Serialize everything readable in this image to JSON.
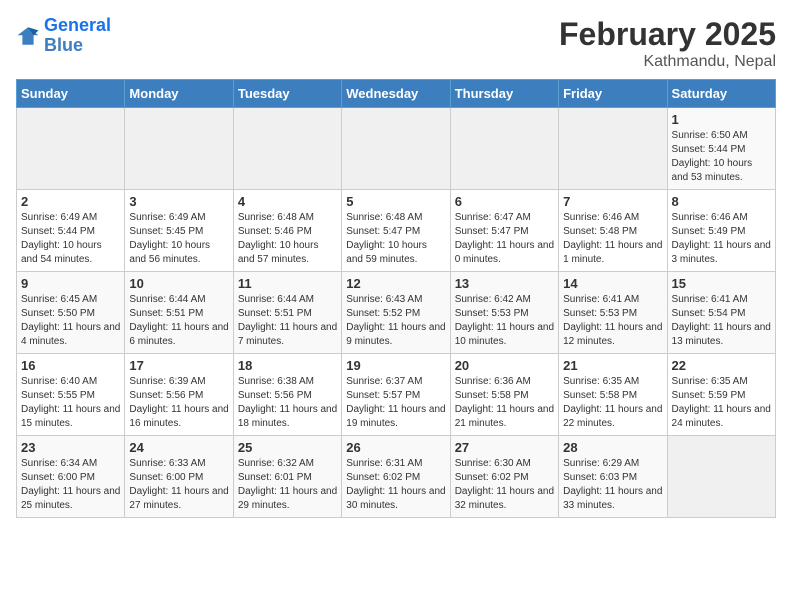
{
  "header": {
    "logo_line1": "General",
    "logo_line2": "Blue",
    "month_title": "February 2025",
    "location": "Kathmandu, Nepal"
  },
  "weekdays": [
    "Sunday",
    "Monday",
    "Tuesday",
    "Wednesday",
    "Thursday",
    "Friday",
    "Saturday"
  ],
  "weeks": [
    [
      {
        "day": "",
        "info": ""
      },
      {
        "day": "",
        "info": ""
      },
      {
        "day": "",
        "info": ""
      },
      {
        "day": "",
        "info": ""
      },
      {
        "day": "",
        "info": ""
      },
      {
        "day": "",
        "info": ""
      },
      {
        "day": "1",
        "info": "Sunrise: 6:50 AM\nSunset: 5:44 PM\nDaylight: 10 hours\nand 53 minutes."
      }
    ],
    [
      {
        "day": "2",
        "info": "Sunrise: 6:49 AM\nSunset: 5:44 PM\nDaylight: 10 hours\nand 54 minutes."
      },
      {
        "day": "3",
        "info": "Sunrise: 6:49 AM\nSunset: 5:45 PM\nDaylight: 10 hours\nand 56 minutes."
      },
      {
        "day": "4",
        "info": "Sunrise: 6:48 AM\nSunset: 5:46 PM\nDaylight: 10 hours\nand 57 minutes."
      },
      {
        "day": "5",
        "info": "Sunrise: 6:48 AM\nSunset: 5:47 PM\nDaylight: 10 hours\nand 59 minutes."
      },
      {
        "day": "6",
        "info": "Sunrise: 6:47 AM\nSunset: 5:47 PM\nDaylight: 11 hours\nand 0 minutes."
      },
      {
        "day": "7",
        "info": "Sunrise: 6:46 AM\nSunset: 5:48 PM\nDaylight: 11 hours\nand 1 minute."
      },
      {
        "day": "8",
        "info": "Sunrise: 6:46 AM\nSunset: 5:49 PM\nDaylight: 11 hours\nand 3 minutes."
      }
    ],
    [
      {
        "day": "9",
        "info": "Sunrise: 6:45 AM\nSunset: 5:50 PM\nDaylight: 11 hours\nand 4 minutes."
      },
      {
        "day": "10",
        "info": "Sunrise: 6:44 AM\nSunset: 5:51 PM\nDaylight: 11 hours\nand 6 minutes."
      },
      {
        "day": "11",
        "info": "Sunrise: 6:44 AM\nSunset: 5:51 PM\nDaylight: 11 hours\nand 7 minutes."
      },
      {
        "day": "12",
        "info": "Sunrise: 6:43 AM\nSunset: 5:52 PM\nDaylight: 11 hours\nand 9 minutes."
      },
      {
        "day": "13",
        "info": "Sunrise: 6:42 AM\nSunset: 5:53 PM\nDaylight: 11 hours\nand 10 minutes."
      },
      {
        "day": "14",
        "info": "Sunrise: 6:41 AM\nSunset: 5:53 PM\nDaylight: 11 hours\nand 12 minutes."
      },
      {
        "day": "15",
        "info": "Sunrise: 6:41 AM\nSunset: 5:54 PM\nDaylight: 11 hours\nand 13 minutes."
      }
    ],
    [
      {
        "day": "16",
        "info": "Sunrise: 6:40 AM\nSunset: 5:55 PM\nDaylight: 11 hours\nand 15 minutes."
      },
      {
        "day": "17",
        "info": "Sunrise: 6:39 AM\nSunset: 5:56 PM\nDaylight: 11 hours\nand 16 minutes."
      },
      {
        "day": "18",
        "info": "Sunrise: 6:38 AM\nSunset: 5:56 PM\nDaylight: 11 hours\nand 18 minutes."
      },
      {
        "day": "19",
        "info": "Sunrise: 6:37 AM\nSunset: 5:57 PM\nDaylight: 11 hours\nand 19 minutes."
      },
      {
        "day": "20",
        "info": "Sunrise: 6:36 AM\nSunset: 5:58 PM\nDaylight: 11 hours\nand 21 minutes."
      },
      {
        "day": "21",
        "info": "Sunrise: 6:35 AM\nSunset: 5:58 PM\nDaylight: 11 hours\nand 22 minutes."
      },
      {
        "day": "22",
        "info": "Sunrise: 6:35 AM\nSunset: 5:59 PM\nDaylight: 11 hours\nand 24 minutes."
      }
    ],
    [
      {
        "day": "23",
        "info": "Sunrise: 6:34 AM\nSunset: 6:00 PM\nDaylight: 11 hours\nand 25 minutes."
      },
      {
        "day": "24",
        "info": "Sunrise: 6:33 AM\nSunset: 6:00 PM\nDaylight: 11 hours\nand 27 minutes."
      },
      {
        "day": "25",
        "info": "Sunrise: 6:32 AM\nSunset: 6:01 PM\nDaylight: 11 hours\nand 29 minutes."
      },
      {
        "day": "26",
        "info": "Sunrise: 6:31 AM\nSunset: 6:02 PM\nDaylight: 11 hours\nand 30 minutes."
      },
      {
        "day": "27",
        "info": "Sunrise: 6:30 AM\nSunset: 6:02 PM\nDaylight: 11 hours\nand 32 minutes."
      },
      {
        "day": "28",
        "info": "Sunrise: 6:29 AM\nSunset: 6:03 PM\nDaylight: 11 hours\nand 33 minutes."
      },
      {
        "day": "",
        "info": ""
      }
    ]
  ]
}
